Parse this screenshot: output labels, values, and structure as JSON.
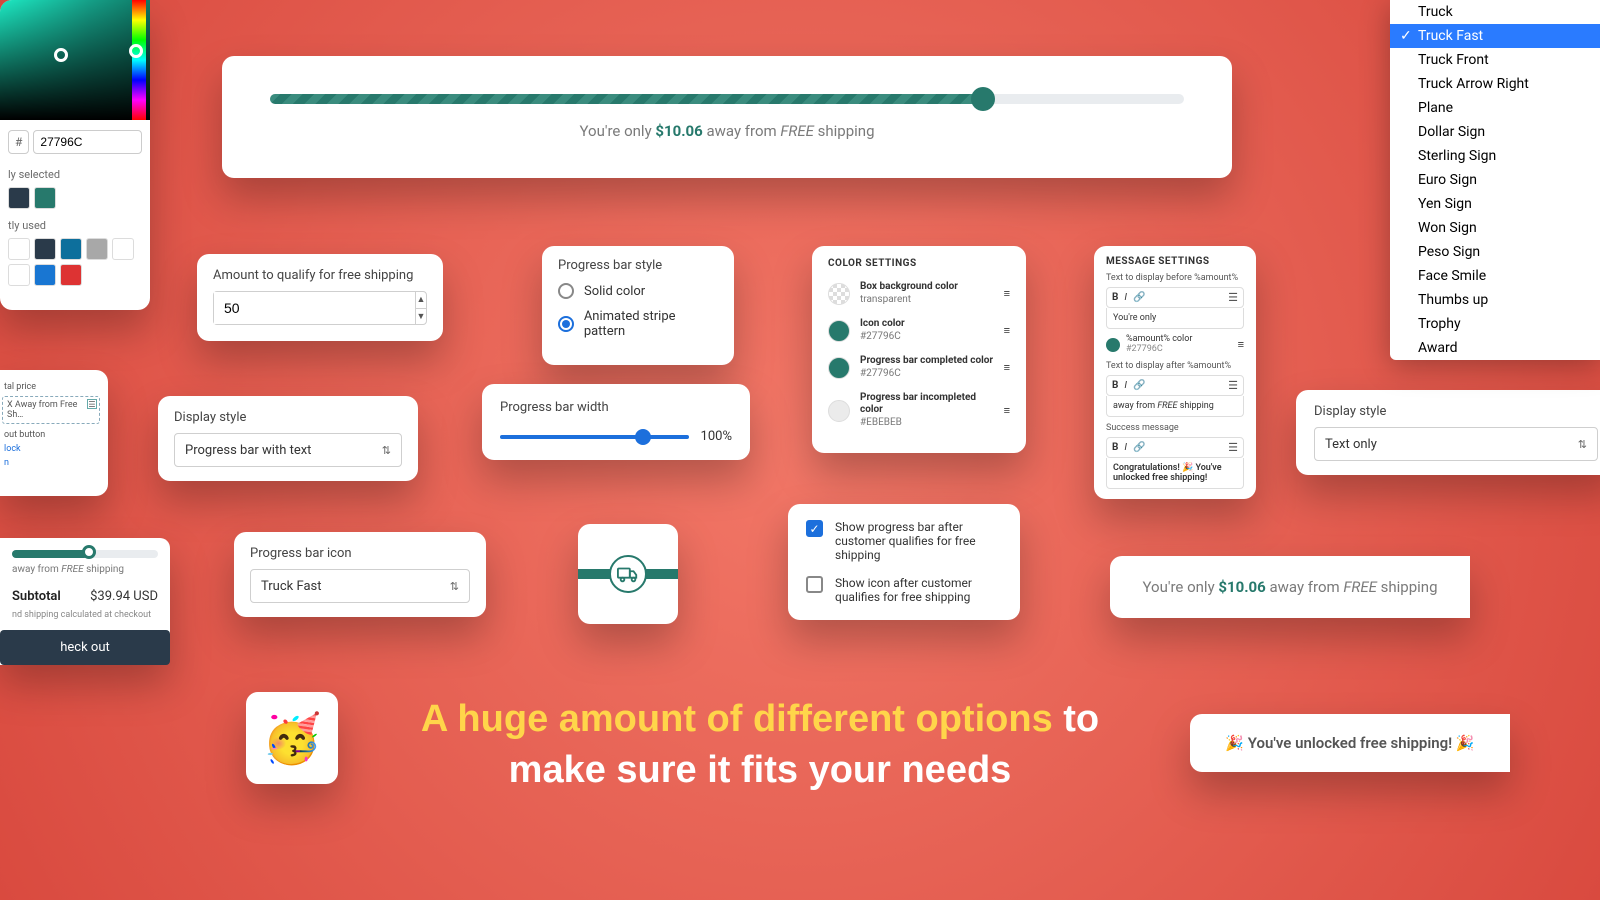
{
  "hero": {
    "before": "You're only ",
    "amount": "$10.06",
    "after_1": " away from ",
    "free": "FREE",
    "after_2": " shipping"
  },
  "picker": {
    "hex": "27796C",
    "currently_selected_label": "ly selected",
    "recently_used_label": "tly used",
    "selected_swatches": [
      "#2a3a4a",
      "#27796C"
    ],
    "recent_swatches": [
      "#ffffff",
      "#2a3a4a",
      "#0d6f9c",
      "#a8a8a8",
      "#ffffff",
      "#ffffff",
      "#1976d2",
      "#d33"
    ]
  },
  "amount": {
    "label": "Amount to qualify for free shipping",
    "value": "50"
  },
  "style": {
    "title": "Progress bar style",
    "opt1": "Solid color",
    "opt2": "Animated stripe pattern"
  },
  "color_settings": {
    "title": "COLOR SETTINGS",
    "rows": [
      {
        "name": "Box background color",
        "sub": "transparent",
        "type": "transparent"
      },
      {
        "name": "Icon color",
        "sub": "#27796C",
        "color": "#27796C"
      },
      {
        "name": "Progress bar completed color",
        "sub": "#27796C",
        "color": "#27796C"
      },
      {
        "name": "Progress bar incompleted color",
        "sub": "#EBEBEB",
        "color": "#EBEBEB"
      }
    ]
  },
  "msg": {
    "title": "MESSAGE SETTINGS",
    "before_label": "Text to display before %amount%",
    "before_value": "You're only",
    "amount_color_label": "%amount% color",
    "amount_color_sub": "#27796C",
    "after_label": "Text to display after %amount%",
    "after_value": "away from FREE shipping",
    "success_label": "Success message",
    "success_value": "Congratulations! 🎉 You've unlocked free shipping!"
  },
  "display": {
    "label": "Display style",
    "value": "Progress bar with text"
  },
  "width": {
    "title": "Progress bar width",
    "value": "100%"
  },
  "display_right": {
    "label": "Display style",
    "value": "Text only"
  },
  "icon_select": {
    "label": "Progress bar icon",
    "value": "Truck Fast"
  },
  "checks": {
    "opt1": "Show progress bar after customer qualifies for free shipping",
    "opt2": "Show icon after customer qualifies for free shipping"
  },
  "text_only": {
    "before": "You're only ",
    "amount": "$10.06",
    "after_1": " away from ",
    "free": "FREE",
    "after_2": " shipping"
  },
  "emoji": "🥳",
  "slogan": {
    "accent": "A huge amount of different options",
    "rest1": " to",
    "rest2": "make sure it fits your needs"
  },
  "unlocked": "🎉 You've unlocked free shipping! 🎉",
  "theme": {
    "line1": "tal price",
    "box": "X Away from Free Sh…",
    "line2": "out button",
    "line3": "lock",
    "line4": "n"
  },
  "subtotal": {
    "msg_before": "away from ",
    "msg_free": "FREE",
    "msg_after": " shipping",
    "label": "Subtotal",
    "value": "$39.94 USD",
    "note": "nd shipping calculated at checkout",
    "btn": "heck out"
  },
  "dropdown": {
    "items": [
      "Truck",
      "Truck Fast",
      "Truck Front",
      "Truck Arrow Right",
      "Plane",
      "Dollar Sign",
      "Sterling Sign",
      "Euro Sign",
      "Yen Sign",
      "Won Sign",
      "Peso Sign",
      "Face Smile",
      "Thumbs up",
      "Trophy",
      "Award"
    ],
    "selected_index": 1
  }
}
